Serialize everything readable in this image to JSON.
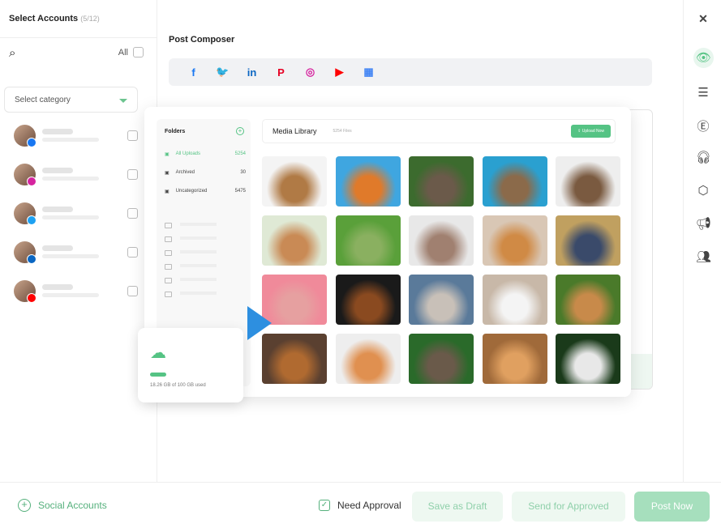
{
  "left_panel": {
    "title": "Select Accounts",
    "count": "(5/12)",
    "all_label": "All",
    "category_placeholder": "Select category",
    "accounts": [
      {
        "network": "facebook",
        "color": "#1877f2"
      },
      {
        "network": "instagram",
        "color": "#d6249f"
      },
      {
        "network": "twitter",
        "color": "#1da1f2"
      },
      {
        "network": "linkedin",
        "color": "#0a66c2"
      },
      {
        "network": "youtube",
        "color": "#ff0000"
      }
    ]
  },
  "composer": {
    "title": "Post Composer",
    "networks": [
      {
        "name": "facebook",
        "glyph": "f",
        "color": "#1877f2"
      },
      {
        "name": "twitter",
        "glyph": "🐦",
        "color": "#1da1f2"
      },
      {
        "name": "linkedin",
        "glyph": "in",
        "color": "#0a66c2"
      },
      {
        "name": "pinterest",
        "glyph": "P",
        "color": "#e60023"
      },
      {
        "name": "instagram",
        "glyph": "◎",
        "color": "#d6249f"
      },
      {
        "name": "youtube",
        "glyph": "▶",
        "color": "#ff0000"
      },
      {
        "name": "google-business",
        "glyph": "▦",
        "color": "#4285f4"
      }
    ]
  },
  "media_library": {
    "folders_title": "Folders",
    "title": "Media Library",
    "file_count": "5254 Files",
    "upload_label": "Upload Now",
    "folders": [
      {
        "name": "All Uploads",
        "count": "5254",
        "active": true
      },
      {
        "name": "Archived",
        "count": "30"
      },
      {
        "name": "Uncategorized",
        "count": "5475"
      }
    ],
    "storage": "18.26 GB of 100 GB used",
    "storage_fraction": 0.18
  },
  "bottom": {
    "social_accounts": "Social Accounts",
    "need_approval": "Need Approval",
    "need_approval_checked": true,
    "save_draft": "Save as Draft",
    "send_approval": "Send for Approved",
    "post_now": "Post Now"
  },
  "accent": "#55c384"
}
